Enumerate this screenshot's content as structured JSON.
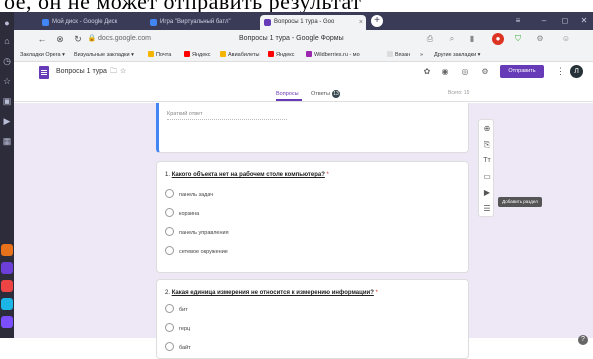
{
  "caption": "ое, он не может отправить результат",
  "browser": {
    "tabs": [
      {
        "label": "Мой диск - Google Диск",
        "color": "#4285f4"
      },
      {
        "label": "Игра \"Виртуальный батл\"",
        "color": "#4285f4"
      },
      {
        "label": "Вопросы 1 тура - Goo",
        "color": "#673ab7"
      }
    ],
    "close_symbol": "×",
    "new_tab_symbol": "+",
    "url": "docs.google.com",
    "page_title": "Вопросы 1 тура - Google Формы",
    "bookmarks": [
      {
        "label": "Закладки Opera ▾",
        "color": ""
      },
      {
        "label": "Визуальные закладки ▾",
        "color": ""
      },
      {
        "label": "Почта",
        "color": "#f4b400"
      },
      {
        "label": "Яндекс",
        "color": "#ff0000"
      },
      {
        "label": "Авиабилеты",
        "color": "#f4b400"
      },
      {
        "label": "Яндекс",
        "color": "#ff0000"
      },
      {
        "label": "Wildberries.ru - мо",
        "color": "#9c27b0"
      },
      {
        "label": "Вязан",
        "color": "#ddd"
      },
      {
        "label": "»",
        "color": ""
      },
      {
        "label": "Другие закладки ▾",
        "color": ""
      }
    ]
  },
  "form": {
    "title": "Вопросы 1 тура",
    "send_label": "Отправить",
    "avatar_letter": "Л",
    "tab_questions": "Вопросы",
    "tab_answers": "Ответы",
    "answers_count": "13",
    "total": "Всего: 15",
    "short_answer": "Краткий ответ",
    "questions": [
      {
        "number": "1.",
        "text": "Какого объекта нет на рабочем столе компьютера?",
        "required": "*",
        "options": [
          "панель задач",
          "корзина",
          "панель управления",
          "сетевое окружение"
        ]
      },
      {
        "number": "2.",
        "text": "Какая единица измерения не относится к измерению информации?",
        "required": "*",
        "options": [
          "бит",
          "герц",
          "байт"
        ]
      }
    ],
    "tooltip": "Добавить раздел"
  },
  "colors": {
    "accent": "#673ab7",
    "selected_border": "#4285f4",
    "opera_bg": "#2c2c3a"
  }
}
